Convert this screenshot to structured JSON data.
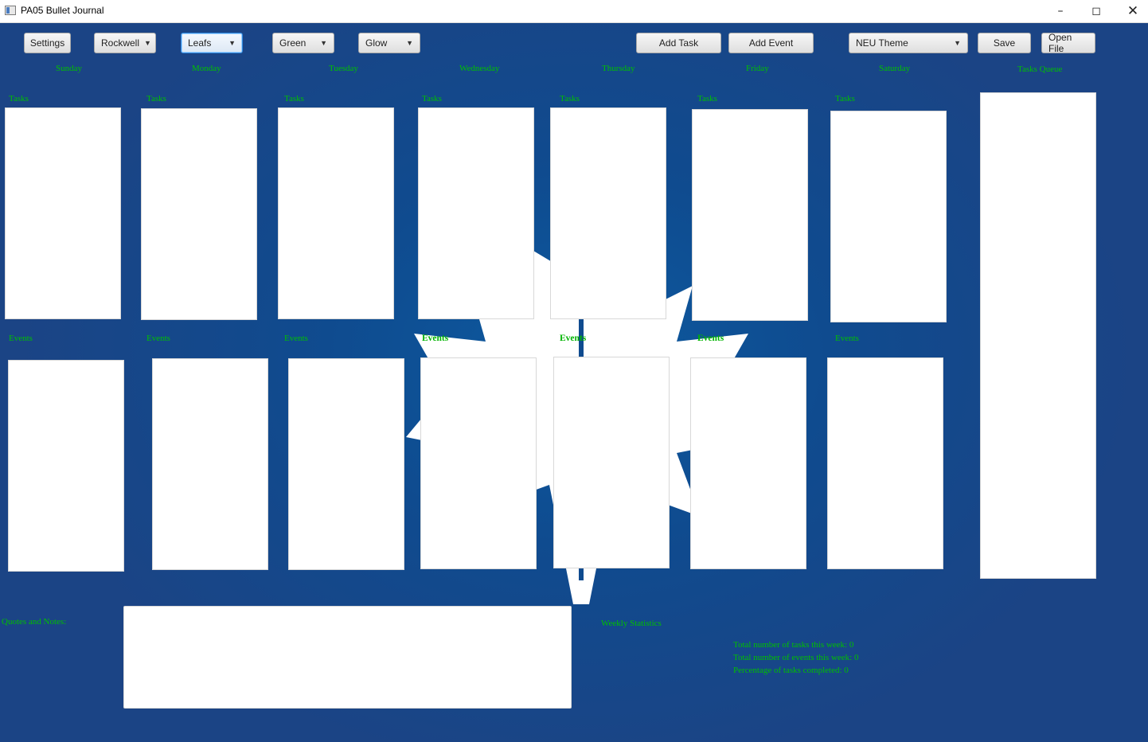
{
  "window": {
    "title": "PA05 Bullet Journal"
  },
  "toolbar": {
    "settings_label": "Settings",
    "font_combo": "Rockwell",
    "image_combo": "Leafs",
    "color_combo": "Green",
    "effect_combo": "Glow",
    "add_task_label": "Add Task",
    "add_event_label": "Add Event",
    "theme_combo": "NEU Theme",
    "save_label": "Save",
    "open_file_label": "Open File"
  },
  "days": [
    {
      "name": "Sunday",
      "tasks_label": "Tasks",
      "events_label": "Events"
    },
    {
      "name": "Monday",
      "tasks_label": "Tasks",
      "events_label": "Events"
    },
    {
      "name": "Tuesday",
      "tasks_label": "Tasks",
      "events_label": "Events"
    },
    {
      "name": "Wednesday",
      "tasks_label": "Tasks",
      "events_label": "Events"
    },
    {
      "name": "Thursday",
      "tasks_label": "Tasks",
      "events_label": "Events"
    },
    {
      "name": "Friday",
      "tasks_label": "Tasks",
      "events_label": "Events"
    },
    {
      "name": "Saturday",
      "tasks_label": "Tasks",
      "events_label": "Events"
    }
  ],
  "queue": {
    "title": "Tasks Queue"
  },
  "notes": {
    "label": "Quotes and Notes:"
  },
  "stats": {
    "title": "Weekly Statistics",
    "tasks_line": "Total number of tasks this week: 0",
    "events_line": "Total number of events this week: 0",
    "percent_line": "Percentage of tasks completed: 0"
  },
  "colors": {
    "accent_text": "#00c000",
    "background": "#1d4683",
    "leaf": "#ffffff"
  }
}
